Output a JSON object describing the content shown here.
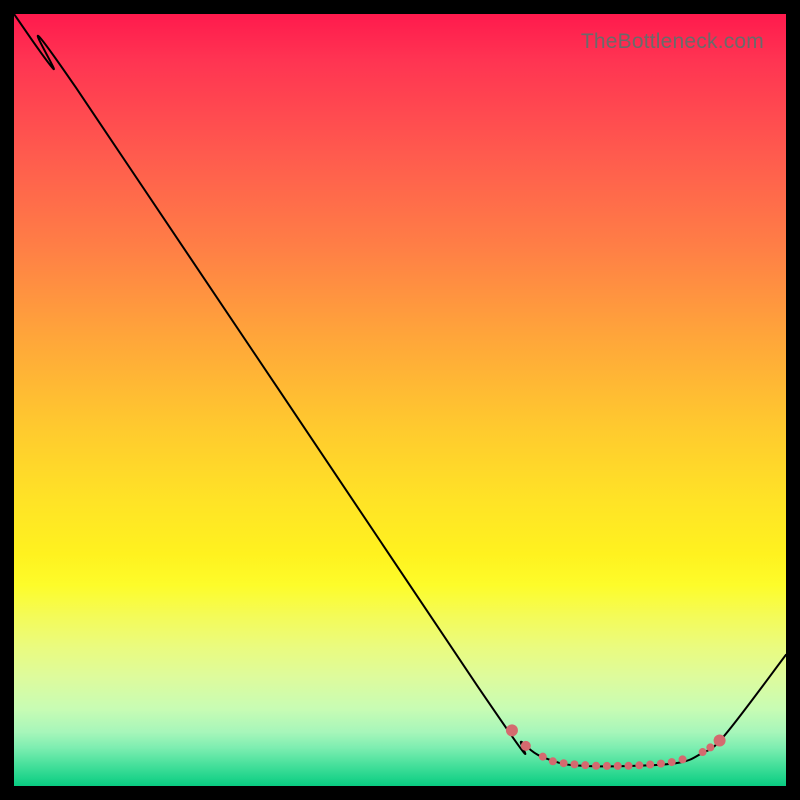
{
  "watermark": "TheBottleneck.com",
  "colors": {
    "curve": "#000000",
    "dots": "#d46a6f"
  },
  "chart_data": {
    "type": "line",
    "title": "",
    "xlabel": "",
    "ylabel": "",
    "xlim": [
      0,
      100
    ],
    "ylim": [
      0,
      100
    ],
    "curve_points": [
      {
        "x": 0,
        "y": 100
      },
      {
        "x": 5,
        "y": 93
      },
      {
        "x": 8,
        "y": 90.5
      },
      {
        "x": 60,
        "y": 13
      },
      {
        "x": 66,
        "y": 5.5
      },
      {
        "x": 70,
        "y": 3.2
      },
      {
        "x": 74,
        "y": 2.6
      },
      {
        "x": 80,
        "y": 2.6
      },
      {
        "x": 86,
        "y": 3.0
      },
      {
        "x": 89,
        "y": 4.2
      },
      {
        "x": 92,
        "y": 6.5
      },
      {
        "x": 100,
        "y": 17
      }
    ],
    "highlight_dots": [
      {
        "x": 64.5,
        "y": 7.2,
        "r": 6
      },
      {
        "x": 66.3,
        "y": 5.2,
        "r": 5
      },
      {
        "x": 68.5,
        "y": 3.8,
        "r": 4
      },
      {
        "x": 69.8,
        "y": 3.2,
        "r": 4
      },
      {
        "x": 71.2,
        "y": 2.95,
        "r": 4
      },
      {
        "x": 72.6,
        "y": 2.8,
        "r": 4
      },
      {
        "x": 74.0,
        "y": 2.7,
        "r": 4
      },
      {
        "x": 75.4,
        "y": 2.62,
        "r": 4
      },
      {
        "x": 76.8,
        "y": 2.6,
        "r": 4
      },
      {
        "x": 78.2,
        "y": 2.6,
        "r": 4
      },
      {
        "x": 79.6,
        "y": 2.62,
        "r": 4
      },
      {
        "x": 81.0,
        "y": 2.68,
        "r": 4
      },
      {
        "x": 82.4,
        "y": 2.78,
        "r": 4
      },
      {
        "x": 83.8,
        "y": 2.9,
        "r": 4
      },
      {
        "x": 85.2,
        "y": 3.1,
        "r": 4
      },
      {
        "x": 86.6,
        "y": 3.45,
        "r": 4
      },
      {
        "x": 89.2,
        "y": 4.4,
        "r": 4
      },
      {
        "x": 90.2,
        "y": 5.0,
        "r": 4
      },
      {
        "x": 91.4,
        "y": 5.9,
        "r": 6
      }
    ]
  }
}
